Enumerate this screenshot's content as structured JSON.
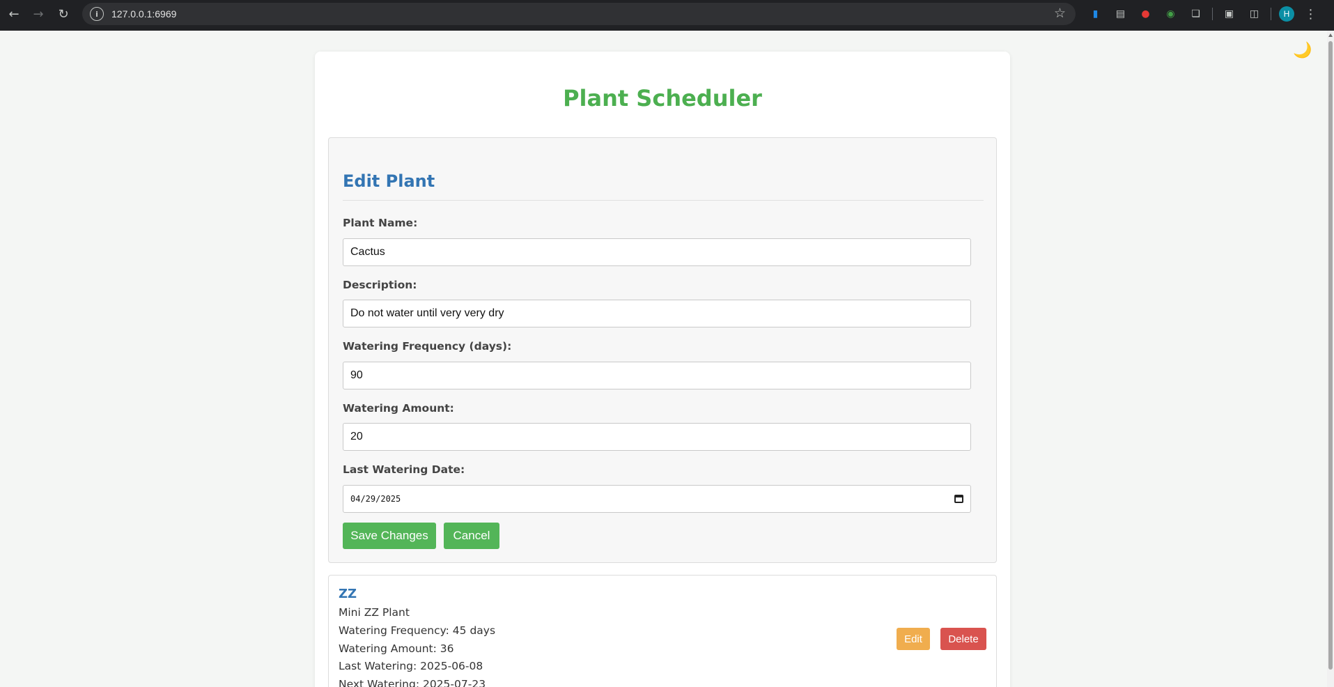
{
  "browser": {
    "url": "127.0.0.1:6969",
    "profile_initial": "H"
  },
  "app": {
    "title": "Plant Scheduler",
    "theme_toggle": "🌙"
  },
  "edit_form": {
    "heading": "Edit Plant",
    "fields": [
      {
        "label": "Plant Name:",
        "value": "Cactus"
      },
      {
        "label": "Description:",
        "value": "Do not water until very very dry"
      },
      {
        "label": "Watering Frequency (days):",
        "value": "90"
      },
      {
        "label": "Watering Amount:",
        "value": "20"
      },
      {
        "label": "Last Watering Date:",
        "value": "04/29/2025"
      }
    ],
    "save_label": "Save Changes",
    "cancel_label": "Cancel"
  },
  "plants": [
    {
      "name": "ZZ",
      "description": "Mini ZZ Plant",
      "frequency": "Watering Frequency: 45 days",
      "amount": "Watering Amount: 36",
      "last_watering": "Last Watering: 2025-06-08",
      "next_watering": "Next Watering: 2025-07-23",
      "edit_label": "Edit",
      "delete_label": "Delete"
    }
  ]
}
